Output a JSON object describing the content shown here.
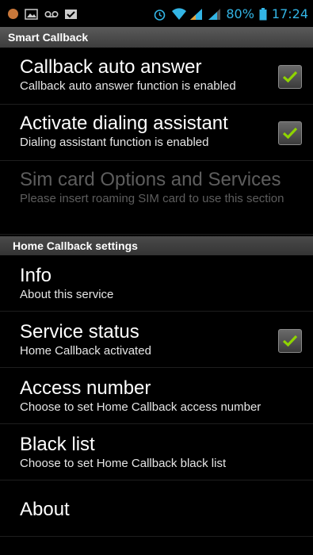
{
  "status_bar": {
    "battery": "80%",
    "time": "17:24"
  },
  "app": {
    "title": "Smart Callback"
  },
  "settings": [
    {
      "title": "Callback auto answer",
      "summary": "Callback auto answer function is enabled",
      "checked": true
    },
    {
      "title": "Activate dialing assistant",
      "summary": "Dialing assistant function is enabled",
      "checked": true
    },
    {
      "title": "Sim card Options and Services",
      "summary": "Please insert roaming SIM card to use this section",
      "enabled": false
    }
  ],
  "home_section": {
    "header": "Home Callback settings"
  },
  "home_items": [
    {
      "title": "Info",
      "summary": "About this service"
    },
    {
      "title": "Service status",
      "summary": "Home Callback activated",
      "checked": true
    },
    {
      "title": "Access number",
      "summary": "Choose to set Home Callback access number"
    },
    {
      "title": "Black list",
      "summary": "Choose to set Home Callback black list"
    },
    {
      "title": "About"
    }
  ],
  "colors": {
    "accent": "#33b5e5",
    "check": "#8fd400"
  }
}
